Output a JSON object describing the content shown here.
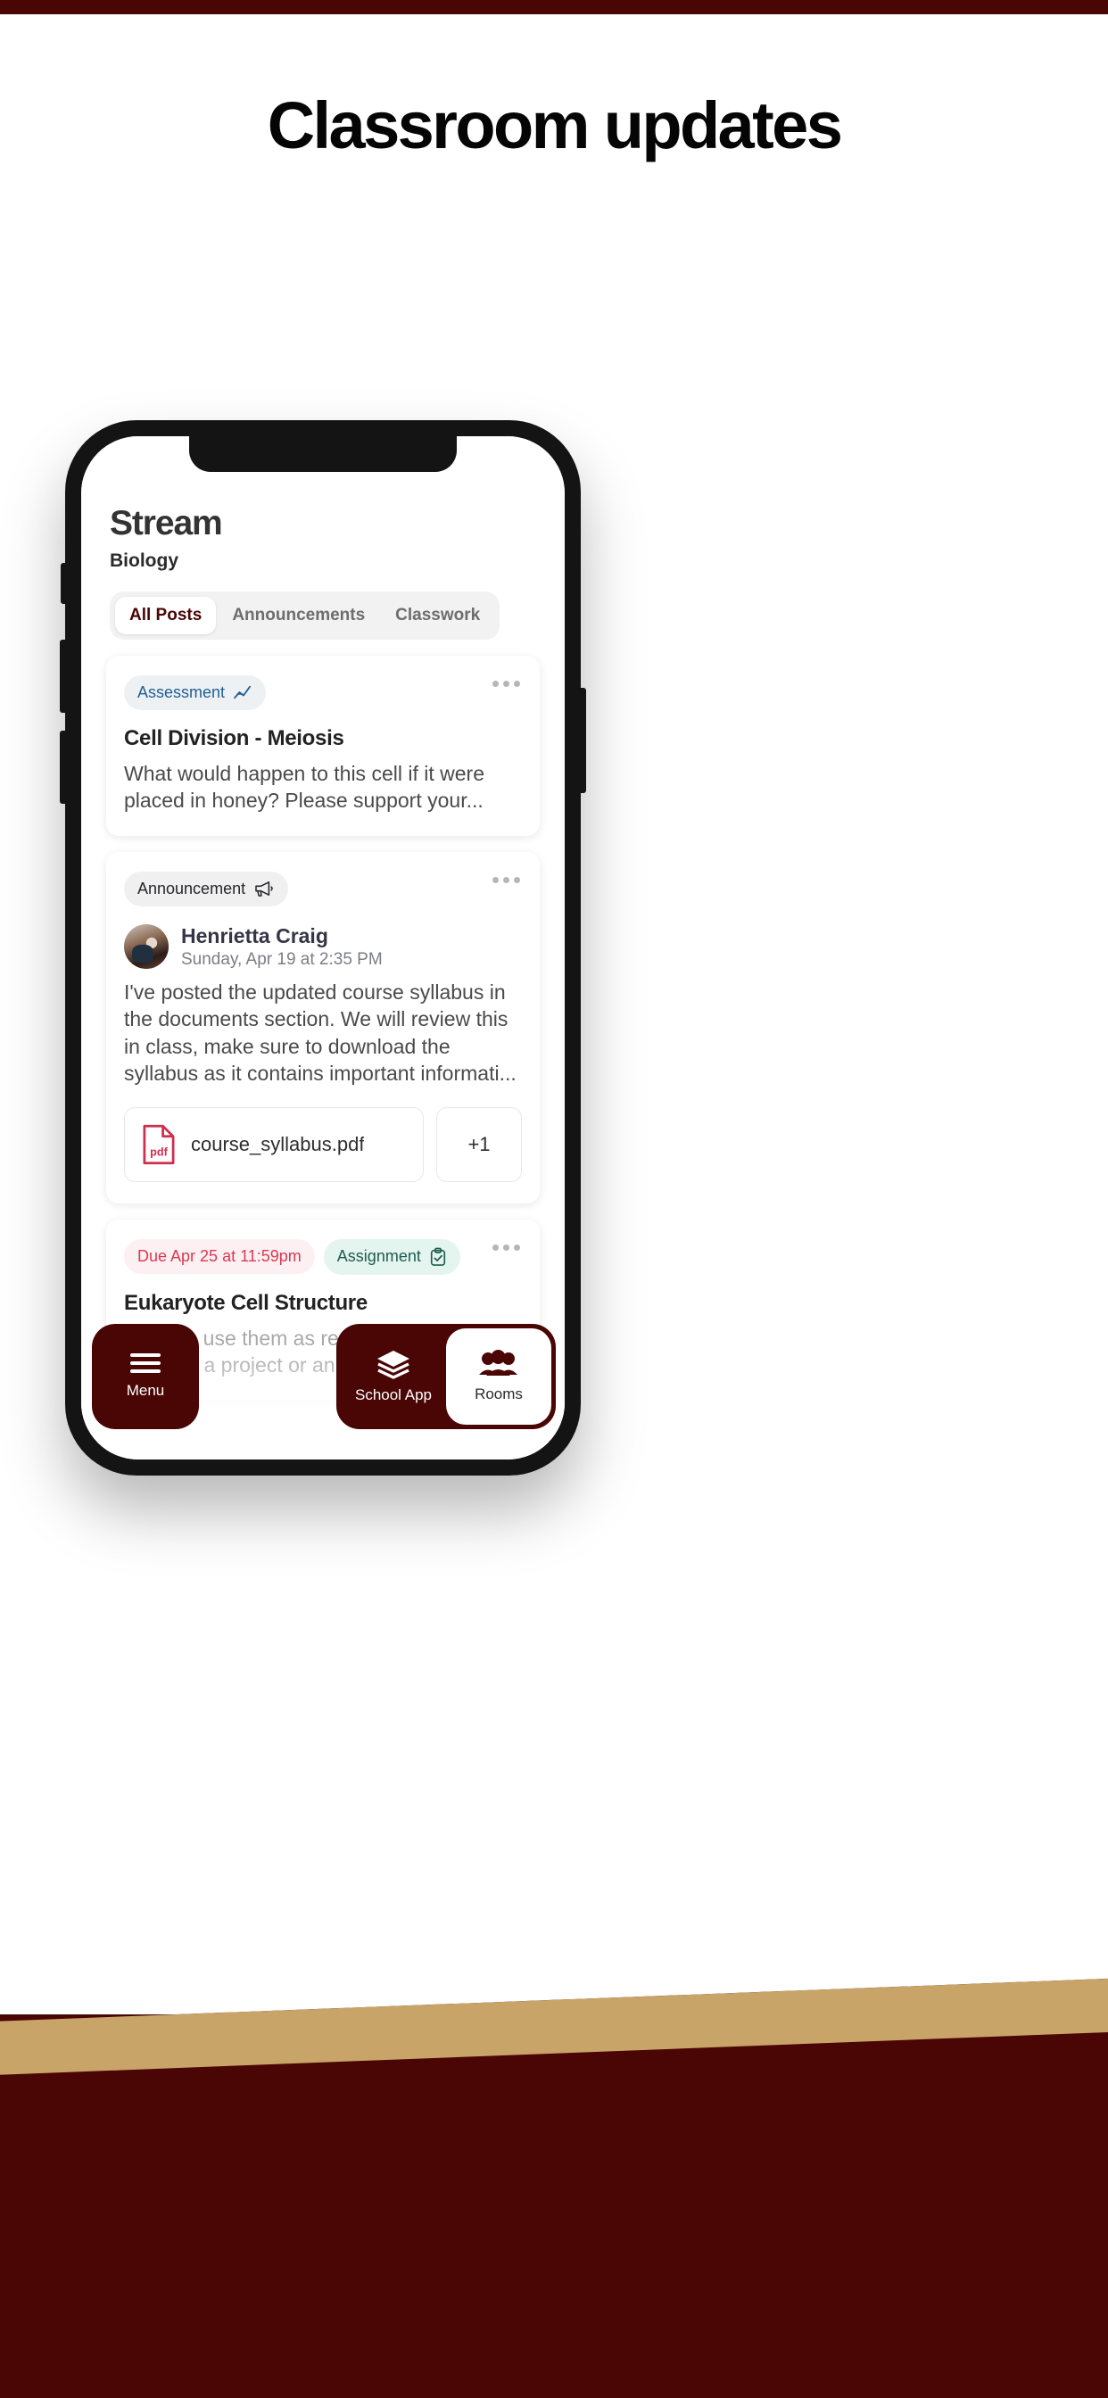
{
  "hero": {
    "title": "Classroom updates"
  },
  "theme": {
    "maroon": "#4a0505",
    "gold": "#c9a468",
    "assessment_accent": "#1f5f94",
    "assignment_accent": "#1d5c4c",
    "due_accent": "#d93a52",
    "pdf_accent": "#cf2e4e"
  },
  "app": {
    "title": "Stream",
    "subtitle": "Biology",
    "tabs": [
      {
        "label": "All Posts",
        "active": true
      },
      {
        "label": "Announcements",
        "active": false
      },
      {
        "label": "Classwork",
        "active": false
      }
    ],
    "posts": [
      {
        "badge": "Assessment",
        "badge_icon": "line-chart-icon",
        "title": "Cell Division - Meiosis",
        "body": "What would happen to this cell if it were placed in honey? Please support your...",
        "menu_icon": "more-horizontal-icon"
      },
      {
        "badge": "Announcement",
        "badge_icon": "megaphone-icon",
        "author": "Henrietta Craig",
        "timestamp": "Sunday, Apr 19 at 2:35 PM",
        "body": "I've posted the updated course syllabus in the documents section. We will review this in class, make sure to download the syllabus as it contains important informati...",
        "attachment": {
          "name": "course_syllabus.pdf",
          "icon": "pdf-file-icon",
          "icon_label": "pdf"
        },
        "more_attachments": "+1",
        "menu_icon": "more-horizontal-icon"
      },
      {
        "due_badge": "Due Apr 25 at 11:59pm",
        "badge": "Assignment",
        "badge_icon": "clipboard-check-icon",
        "title": "Eukaryote Cell Structure",
        "body": "You can use them as resources to go to for help, for a project or an assignment. The",
        "menu_icon": "more-horizontal-icon"
      }
    ],
    "bottom_nav": {
      "menu": {
        "label": "Menu",
        "icon": "hamburger-icon"
      },
      "items": [
        {
          "label": "School App",
          "icon": "layers-icon",
          "active": false
        },
        {
          "label": "Rooms",
          "icon": "people-icon",
          "active": true
        }
      ]
    }
  }
}
